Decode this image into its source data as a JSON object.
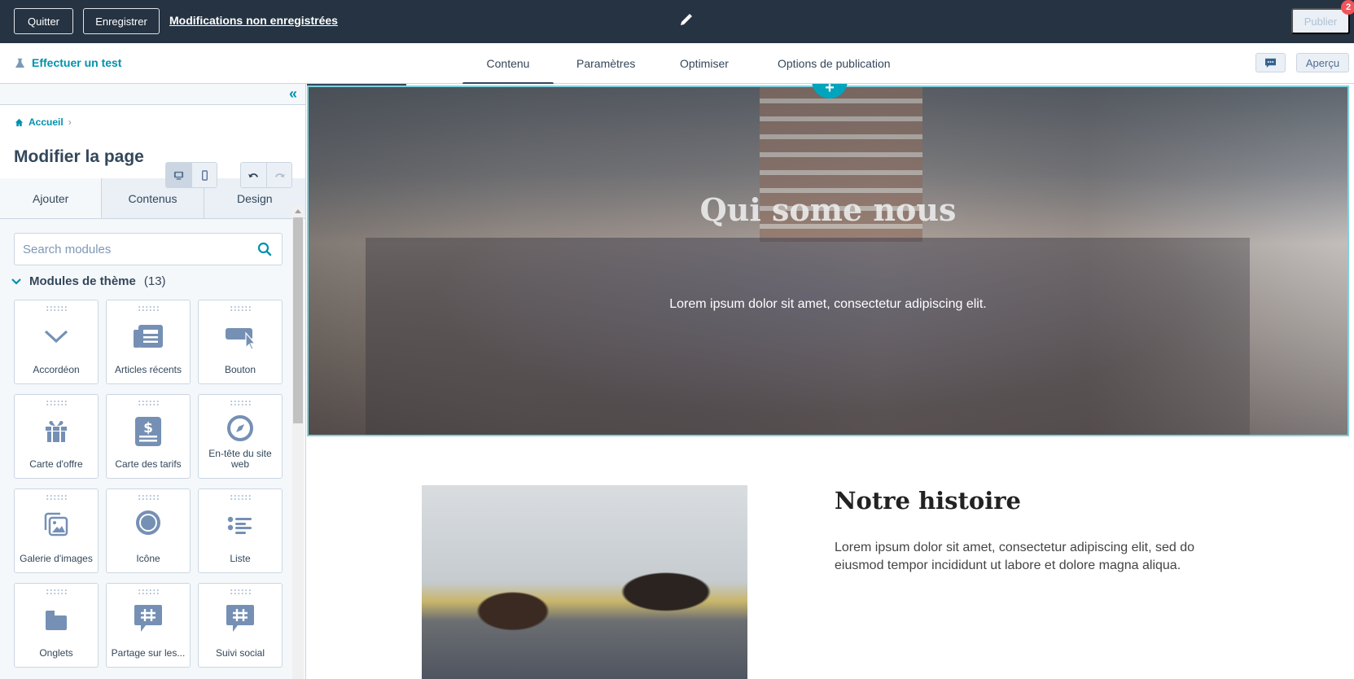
{
  "topbar": {
    "quit_label": "Quitter",
    "save_label": "Enregistrer",
    "unsaved_label": "Modifications non enregistrées",
    "publish_label": "Publier",
    "publish_badge": "2",
    "edit_icon": "pencil-icon"
  },
  "subnav": {
    "test_label": "Effectuer un test",
    "tabs": [
      {
        "label": "Contenu",
        "active": true
      },
      {
        "label": "Paramètres",
        "active": false
      },
      {
        "label": "Optimiser",
        "active": false
      },
      {
        "label": "Options de publication",
        "active": false
      }
    ],
    "preview_label": "Aperçu"
  },
  "sidebar": {
    "collapse_glyph": "«",
    "breadcrumb": {
      "home": "Accueil",
      "separator": "›"
    },
    "title": "Modifier la page",
    "tabs": [
      {
        "label": "Ajouter",
        "active": true
      },
      {
        "label": "Contenus",
        "active": false
      },
      {
        "label": "Design",
        "active": false
      }
    ],
    "search": {
      "placeholder": "Search modules",
      "value": ""
    },
    "section": {
      "title": "Modules de thème",
      "count": "(13)",
      "expanded": true
    },
    "modules": [
      {
        "label": "Accordéon",
        "icon": "chevron-down-icon"
      },
      {
        "label": "Articles récents",
        "icon": "newspaper-icon"
      },
      {
        "label": "Bouton",
        "icon": "button-cursor-icon"
      },
      {
        "label": "Carte d'offre",
        "icon": "gift-icon"
      },
      {
        "label": "Carte des tarifs",
        "icon": "pricing-card-icon"
      },
      {
        "label": "En-tête du site web",
        "icon": "compass-icon"
      },
      {
        "label": "Galerie d'images",
        "icon": "image-gallery-icon"
      },
      {
        "label": "Icône",
        "icon": "badge-icon"
      },
      {
        "label": "Liste",
        "icon": "list-icon"
      },
      {
        "label": "Onglets",
        "icon": "folder-icon"
      },
      {
        "label": "Partage sur les...",
        "icon": "hashtag-bubble-icon"
      },
      {
        "label": "Suivi social",
        "icon": "hashtag-bubble-icon"
      }
    ]
  },
  "canvas": {
    "hero": {
      "title": "Qui some nous",
      "subtitle": "Lorem ipsum dolor sit amet, consectetur adipiscing elit.",
      "add_glyph": "+"
    },
    "story": {
      "title": "Notre histoire",
      "text": "Lorem ipsum dolor sit amet, consectetur adipiscing elit, sed do eiusmod tempor incididunt ut labore et dolore magna aliqua."
    }
  },
  "colors": {
    "topbar_bg": "#253342",
    "accent": "#0091ae",
    "selection_outline": "#7fd1de",
    "badge": "#f2545b",
    "icon": "#7590b4"
  }
}
